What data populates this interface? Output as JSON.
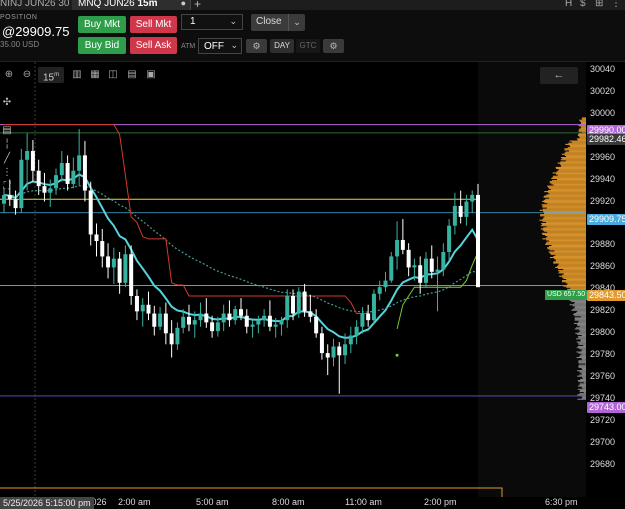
{
  "tabs": {
    "previous_label": "NINJ JUN26 30",
    "active_symbol": "MNQ JUN26",
    "active_interval": "15",
    "active_unit": "m",
    "close_glyph": "●",
    "add_glyph": "+"
  },
  "window_icons": [
    "H",
    "$",
    "⊞",
    "⋮"
  ],
  "position": {
    "label": "POSITION",
    "price": "@29909.75",
    "pnl": "35.00 USD"
  },
  "order": {
    "buy_mkt": "Buy Mkt",
    "sell_mkt": "Sell Mkt",
    "buy_bid": "Buy Bid",
    "sell_ask": "Sell Ask",
    "quantity": "1",
    "close_label": "Close",
    "atm_label": "ATM",
    "atm_value": "OFF",
    "tif_day": "DAY",
    "tif_gtc": "GTC"
  },
  "toolbar": {
    "timeframe": "15",
    "timeframe_unit": "m",
    "back_glyph": "←"
  },
  "crosshair_date": "5/25/2026 5:15:00 pm",
  "time_axis": {
    "partial_date": "/2026",
    "labels": [
      "2:00 am",
      "5:00 am",
      "8:00 am",
      "11:00 am",
      "2:00 pm",
      "6:30 pm"
    ]
  },
  "colors": {
    "buy": "#2e9e4a",
    "sell": "#d1374b",
    "candle_up": "#38b2a0",
    "candle_down": "#ffffff",
    "ema": "#55d4dc",
    "red_line": "#d33a2c",
    "green_line": "#77cc33",
    "yellow_line": "#e5d63a",
    "orange_line": "#e39a2c",
    "profile": "#e59a2b",
    "profile_low": "#8a8a8a",
    "purple_tag": "#b266d6",
    "blue_tag": "#4aaadd"
  },
  "price_tags": {
    "top": "29990.00",
    "top2": "29982.46",
    "current": "29909.75",
    "orange": "29843.50",
    "bottom": "29743.00",
    "usd_badge": "USD 657.50"
  },
  "chart_data": {
    "type": "candlestick",
    "interval": "15m",
    "ylim": [
      29651,
      30047
    ],
    "y_ticks": [
      29680,
      29700,
      29720,
      29740,
      29760,
      29780,
      29800,
      29820,
      29840,
      29860,
      29880,
      29900,
      29920,
      29940,
      29960,
      29980,
      30000,
      30020,
      30040
    ],
    "x_labels": [
      "2:00 am",
      "5:00 am",
      "8:00 am",
      "11:00 am",
      "2:00 pm",
      "6:30 pm"
    ],
    "candles": [
      {
        "o": 29918,
        "h": 29932,
        "l": 29910,
        "c": 29926
      },
      {
        "o": 29926,
        "h": 29940,
        "l": 29916,
        "c": 29922
      },
      {
        "o": 29922,
        "h": 29930,
        "l": 29908,
        "c": 29914
      },
      {
        "o": 29914,
        "h": 29968,
        "l": 29910,
        "c": 29958
      },
      {
        "o": 29958,
        "h": 29982,
        "l": 29930,
        "c": 29966
      },
      {
        "o": 29966,
        "h": 29976,
        "l": 29938,
        "c": 29948
      },
      {
        "o": 29948,
        "h": 29958,
        "l": 29926,
        "c": 29934
      },
      {
        "o": 29934,
        "h": 29946,
        "l": 29920,
        "c": 29928
      },
      {
        "o": 29928,
        "h": 29940,
        "l": 29915,
        "c": 29932
      },
      {
        "o": 29932,
        "h": 29950,
        "l": 29926,
        "c": 29944
      },
      {
        "o": 29944,
        "h": 29966,
        "l": 29938,
        "c": 29955
      },
      {
        "o": 29955,
        "h": 29962,
        "l": 29930,
        "c": 29936
      },
      {
        "o": 29936,
        "h": 29960,
        "l": 29932,
        "c": 29948
      },
      {
        "o": 29948,
        "h": 29986,
        "l": 29935,
        "c": 29962
      },
      {
        "o": 29962,
        "h": 29975,
        "l": 29920,
        "c": 29930
      },
      {
        "o": 29930,
        "h": 29938,
        "l": 29880,
        "c": 29890
      },
      {
        "o": 29890,
        "h": 29900,
        "l": 29870,
        "c": 29884
      },
      {
        "o": 29884,
        "h": 29895,
        "l": 29860,
        "c": 29870
      },
      {
        "o": 29870,
        "h": 29882,
        "l": 29850,
        "c": 29860
      },
      {
        "o": 29860,
        "h": 29878,
        "l": 29845,
        "c": 29868
      },
      {
        "o": 29868,
        "h": 29874,
        "l": 29836,
        "c": 29846
      },
      {
        "o": 29846,
        "h": 29880,
        "l": 29842,
        "c": 29872
      },
      {
        "o": 29872,
        "h": 29880,
        "l": 29826,
        "c": 29834
      },
      {
        "o": 29834,
        "h": 29840,
        "l": 29812,
        "c": 29820
      },
      {
        "o": 29820,
        "h": 29832,
        "l": 29806,
        "c": 29826
      },
      {
        "o": 29826,
        "h": 29838,
        "l": 29812,
        "c": 29818
      },
      {
        "o": 29818,
        "h": 29825,
        "l": 29798,
        "c": 29806
      },
      {
        "o": 29806,
        "h": 29824,
        "l": 29803,
        "c": 29818
      },
      {
        "o": 29818,
        "h": 29828,
        "l": 29790,
        "c": 29800
      },
      {
        "o": 29800,
        "h": 29812,
        "l": 29778,
        "c": 29790
      },
      {
        "o": 29790,
        "h": 29810,
        "l": 29785,
        "c": 29805
      },
      {
        "o": 29805,
        "h": 29822,
        "l": 29800,
        "c": 29815
      },
      {
        "o": 29815,
        "h": 29826,
        "l": 29802,
        "c": 29808
      },
      {
        "o": 29808,
        "h": 29820,
        "l": 29796,
        "c": 29812
      },
      {
        "o": 29812,
        "h": 29828,
        "l": 29806,
        "c": 29818
      },
      {
        "o": 29818,
        "h": 29832,
        "l": 29805,
        "c": 29810
      },
      {
        "o": 29810,
        "h": 29816,
        "l": 29796,
        "c": 29802
      },
      {
        "o": 29802,
        "h": 29815,
        "l": 29797,
        "c": 29810
      },
      {
        "o": 29810,
        "h": 29826,
        "l": 29802,
        "c": 29818
      },
      {
        "o": 29818,
        "h": 29830,
        "l": 29806,
        "c": 29812
      },
      {
        "o": 29812,
        "h": 29825,
        "l": 29808,
        "c": 29822
      },
      {
        "o": 29822,
        "h": 29832,
        "l": 29812,
        "c": 29816
      },
      {
        "o": 29816,
        "h": 29822,
        "l": 29800,
        "c": 29806
      },
      {
        "o": 29806,
        "h": 29812,
        "l": 29796,
        "c": 29808
      },
      {
        "o": 29808,
        "h": 29816,
        "l": 29800,
        "c": 29812
      },
      {
        "o": 29812,
        "h": 29822,
        "l": 29806,
        "c": 29816
      },
      {
        "o": 29816,
        "h": 29830,
        "l": 29802,
        "c": 29806
      },
      {
        "o": 29806,
        "h": 29814,
        "l": 29796,
        "c": 29808
      },
      {
        "o": 29808,
        "h": 29815,
        "l": 29798,
        "c": 29812
      },
      {
        "o": 29812,
        "h": 29840,
        "l": 29805,
        "c": 29834
      },
      {
        "o": 29834,
        "h": 29840,
        "l": 29812,
        "c": 29818
      },
      {
        "o": 29818,
        "h": 29842,
        "l": 29814,
        "c": 29838
      },
      {
        "o": 29838,
        "h": 29845,
        "l": 29815,
        "c": 29820
      },
      {
        "o": 29820,
        "h": 29835,
        "l": 29810,
        "c": 29815
      },
      {
        "o": 29815,
        "h": 29822,
        "l": 29796,
        "c": 29800
      },
      {
        "o": 29800,
        "h": 29806,
        "l": 29776,
        "c": 29782
      },
      {
        "o": 29782,
        "h": 29790,
        "l": 29762,
        "c": 29778
      },
      {
        "o": 29778,
        "h": 29795,
        "l": 29770,
        "c": 29788
      },
      {
        "o": 29788,
        "h": 29792,
        "l": 29745,
        "c": 29780
      },
      {
        "o": 29780,
        "h": 29800,
        "l": 29772,
        "c": 29790
      },
      {
        "o": 29790,
        "h": 29806,
        "l": 29782,
        "c": 29798
      },
      {
        "o": 29798,
        "h": 29812,
        "l": 29790,
        "c": 29806
      },
      {
        "o": 29806,
        "h": 29824,
        "l": 29800,
        "c": 29818
      },
      {
        "o": 29818,
        "h": 29826,
        "l": 29806,
        "c": 29812
      },
      {
        "o": 29812,
        "h": 29840,
        "l": 29808,
        "c": 29836
      },
      {
        "o": 29836,
        "h": 29848,
        "l": 29830,
        "c": 29842
      },
      {
        "o": 29842,
        "h": 29856,
        "l": 29838,
        "c": 29848
      },
      {
        "o": 29848,
        "h": 29874,
        "l": 29846,
        "c": 29870
      },
      {
        "o": 29870,
        "h": 29902,
        "l": 29858,
        "c": 29885
      },
      {
        "o": 29885,
        "h": 29904,
        "l": 29872,
        "c": 29876
      },
      {
        "o": 29876,
        "h": 29882,
        "l": 29852,
        "c": 29860
      },
      {
        "o": 29860,
        "h": 29868,
        "l": 29848,
        "c": 29862
      },
      {
        "o": 29862,
        "h": 29870,
        "l": 29836,
        "c": 29846
      },
      {
        "o": 29846,
        "h": 29874,
        "l": 29842,
        "c": 29868
      },
      {
        "o": 29868,
        "h": 29880,
        "l": 29850,
        "c": 29856
      },
      {
        "o": 29856,
        "h": 29870,
        "l": 29820,
        "c": 29858
      },
      {
        "o": 29858,
        "h": 29882,
        "l": 29852,
        "c": 29874
      },
      {
        "o": 29874,
        "h": 29904,
        "l": 29866,
        "c": 29898
      },
      {
        "o": 29898,
        "h": 29928,
        "l": 29890,
        "c": 29916
      },
      {
        "o": 29916,
        "h": 29930,
        "l": 29900,
        "c": 29906
      },
      {
        "o": 29906,
        "h": 29926,
        "l": 29898,
        "c": 29920
      },
      {
        "o": 29920,
        "h": 29930,
        "l": 29910,
        "c": 29926
      },
      {
        "o": 29926,
        "h": 29936,
        "l": 29878,
        "c": 29842
      }
    ]
  }
}
